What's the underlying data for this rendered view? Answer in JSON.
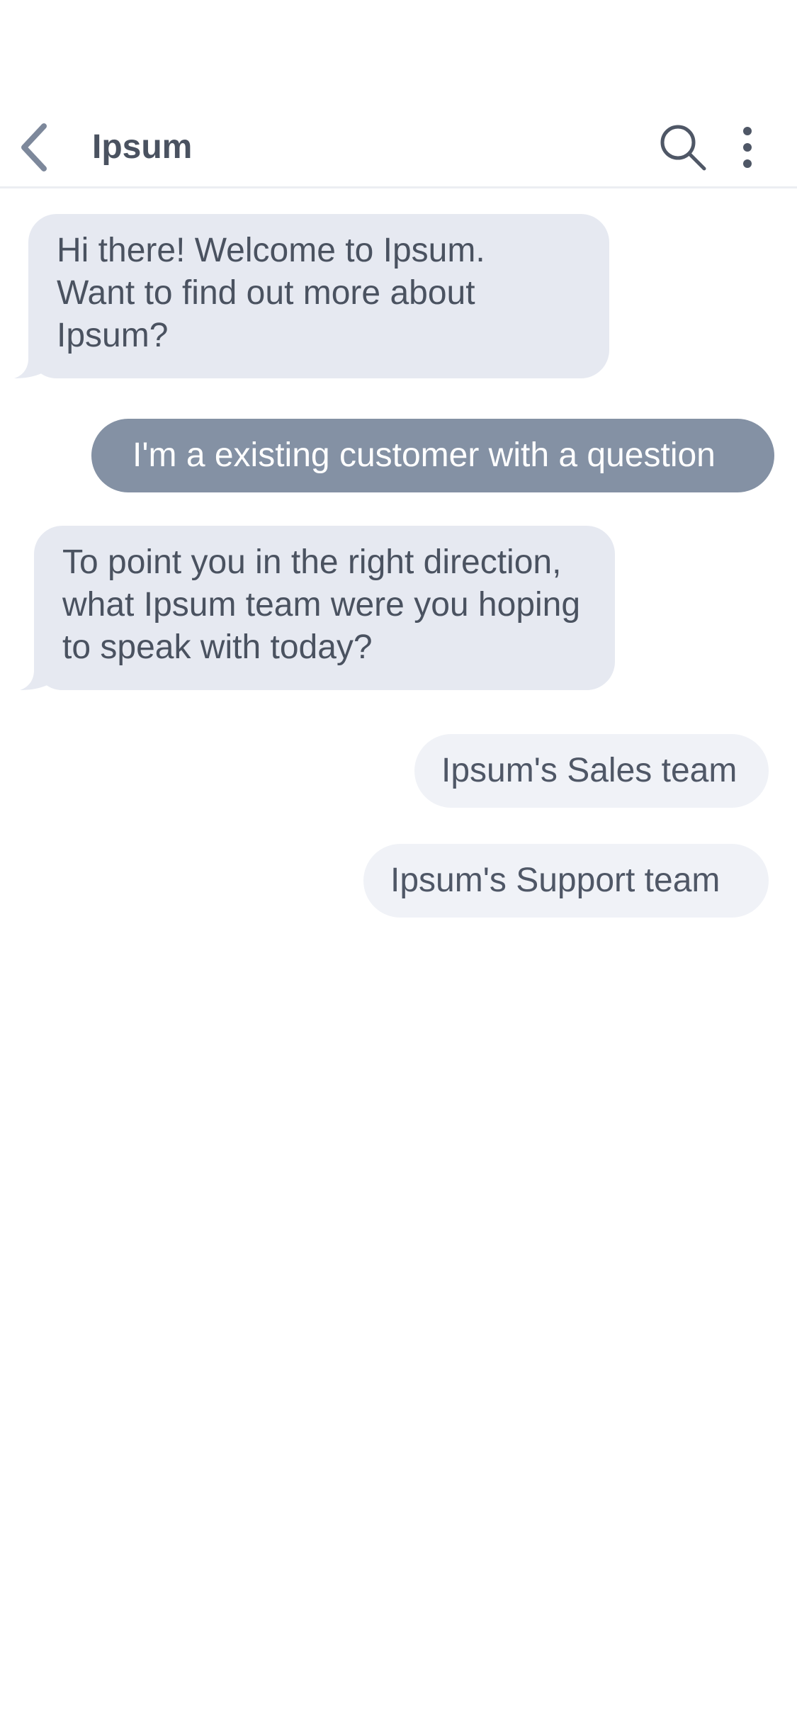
{
  "header": {
    "title": "Ipsum",
    "back_icon": "chevron-left-icon",
    "search_icon": "search-icon",
    "more_icon": "more-vertical-icon"
  },
  "messages": [
    {
      "sender": "bot",
      "text": "Hi there! Welcome to Ipsum.\nWant to find out more about\nIpsum?"
    },
    {
      "sender": "user",
      "text": "I'm a existing customer with a question"
    },
    {
      "sender": "bot",
      "text": "To point you in the right direction,\nwhat Ipsum team were you hoping\nto speak with today?"
    }
  ],
  "quick_replies": [
    {
      "label": "Ipsum's Sales team"
    },
    {
      "label": "Ipsum's Support team"
    }
  ],
  "colors": {
    "bot_bubble": "#e6e9f1",
    "user_bubble": "#8491a4",
    "chip": "#f0f2f7",
    "text": "#4a5260",
    "icon": "#7d889b"
  }
}
